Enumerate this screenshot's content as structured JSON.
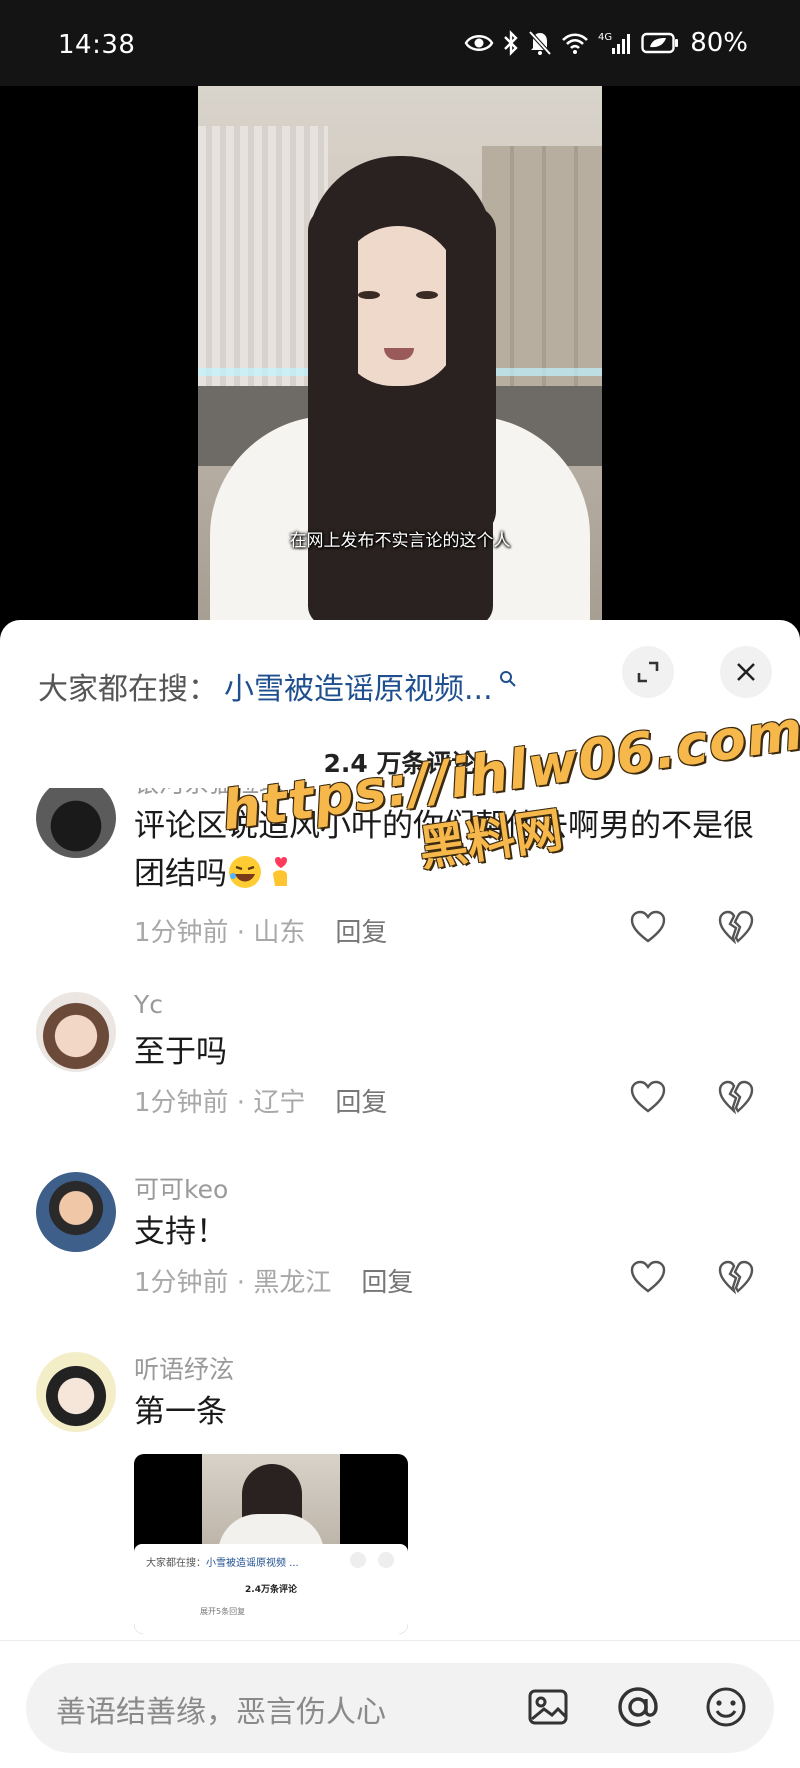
{
  "status_bar": {
    "time": "14:38",
    "network": "4G",
    "battery": "80%"
  },
  "video": {
    "subtitle": "在网上发布不实言论的这个人"
  },
  "sheet": {
    "search_label": "大家都在搜：",
    "search_query": "小雪被造谣原视频...",
    "comment_count": "2.4 万条评论"
  },
  "comments": [
    {
      "user": "银河系猫拉球",
      "text": "评论区说追风小叶的你们帮他去啊男的不是很团结吗",
      "time": "1分钟前",
      "location": "山东",
      "reply": "回复"
    },
    {
      "user": "Yc",
      "text": "至于吗",
      "time": "1分钟前",
      "location": "辽宁",
      "reply": "回复"
    },
    {
      "user": "可可keo",
      "text": "支持！",
      "time": "1分钟前",
      "location": "黑龙江",
      "reply": "回复"
    },
    {
      "user": "听语纾泫",
      "text": "第一条",
      "attachment": {
        "search_label": "大家都在搜：",
        "search_query": "小雪被造谣原视频 ...",
        "comment_count": "2.4万条评论",
        "expand": "展开5条回复"
      }
    }
  ],
  "watermark": {
    "url": "https://ihlw06.com",
    "name": "黑料网"
  },
  "input": {
    "placeholder": "善语结善缘，恶言伤人心"
  },
  "icons": {
    "status": [
      "eye-icon",
      "bluetooth-icon",
      "mute-icon",
      "wifi-icon",
      "signal-icon",
      "battery-icon"
    ],
    "sheet": [
      "search-icon",
      "expand-icon",
      "close-icon"
    ],
    "comment_actions": [
      "heart-icon",
      "broken-heart-icon"
    ],
    "input": [
      "image-icon",
      "at-icon",
      "emoji-icon"
    ]
  },
  "colors": {
    "link": "#1f4f8f",
    "watermark": "#f7b84b"
  }
}
